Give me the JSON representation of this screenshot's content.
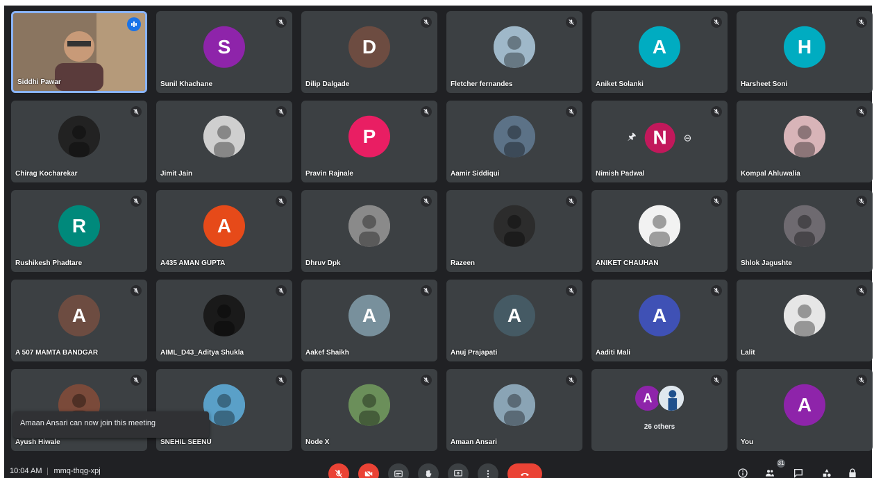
{
  "colors": {
    "background": "#202124",
    "tile": "#3c4043",
    "accent_blue": "#1a73e8",
    "red": "#ea4335"
  },
  "participants": [
    {
      "name": "Siddhi Pawar",
      "type": "video",
      "speaking": true
    },
    {
      "name": "Sunil Khachane",
      "initial": "S",
      "color": "#8e24aa"
    },
    {
      "name": "Dilip Dalgade",
      "initial": "D",
      "color": "#6d4c41"
    },
    {
      "name": "Fletcher fernandes",
      "type": "photo",
      "photo_color": "#9fb8c9"
    },
    {
      "name": "Aniket Solanki",
      "initial": "A",
      "color": "#00acc1"
    },
    {
      "name": "Harsheet Soni",
      "initial": "H",
      "color": "#00acc1"
    },
    {
      "name": "Chirag Kocharekar",
      "type": "photo",
      "photo_color": "#222222"
    },
    {
      "name": "Jimit Jain",
      "type": "photo",
      "photo_color": "#cfcfcf"
    },
    {
      "name": "Pravin Rajnale",
      "initial": "P",
      "color": "#e91e63"
    },
    {
      "name": "Aamir Siddiqui",
      "type": "photo",
      "photo_color": "#5c7287"
    },
    {
      "name": "Nimish Padwal",
      "initial": "N",
      "color": "#c2185b",
      "hovered": true
    },
    {
      "name": "Kompal Ahluwalia",
      "type": "photo",
      "photo_color": "#d8b4b8"
    },
    {
      "name": "Rushikesh Phadtare",
      "initial": "R",
      "color": "#00897b"
    },
    {
      "name": "A435 AMAN GUPTA",
      "initial": "A",
      "color": "#e64a19"
    },
    {
      "name": "Dhruv Dpk",
      "type": "photo",
      "photo_color": "#8a8a8a"
    },
    {
      "name": "Razeen",
      "type": "photo",
      "photo_color": "#2c2c2c"
    },
    {
      "name": "ANIKET CHAUHAN",
      "type": "photo",
      "photo_color": "#f2f2f2"
    },
    {
      "name": "Shlok Jagushte",
      "type": "photo",
      "photo_color": "#6e6a70"
    },
    {
      "name": "A 507 MAMTA BANDGAR",
      "initial": "A",
      "color": "#6d4c41"
    },
    {
      "name": "AIML_D43_Aditya Shukla",
      "type": "photo",
      "photo_color": "#1a1a1a"
    },
    {
      "name": "Aakef Shaikh",
      "initial": "A",
      "color": "#78909c"
    },
    {
      "name": "Anuj Prajapati",
      "initial": "A",
      "color": "#455a64"
    },
    {
      "name": "Aaditi Mali",
      "initial": "A",
      "color": "#3f51b5"
    },
    {
      "name": "Lalit",
      "type": "photo",
      "photo_color": "#e6e6e6"
    },
    {
      "name": "Ayush Hiwale",
      "type": "photo",
      "photo_color": "#7a4a3a"
    },
    {
      "name": "SNEHIL SEENU",
      "type": "photo",
      "photo_color": "#5aa0c8"
    },
    {
      "name": "Node X",
      "type": "photo",
      "photo_color": "#6b8f5a"
    },
    {
      "name": "Amaan Ansari",
      "type": "photo",
      "photo_color": "#8aa4b5"
    },
    {
      "name": "",
      "type": "others",
      "others_label": "26 others",
      "initial": "A",
      "color": "#8e24aa"
    },
    {
      "name": "You",
      "initial": "A",
      "color": "#8e24aa"
    }
  ],
  "notification": "Amaan Ansari can now join this meeting",
  "meeting": {
    "time": "10:04 AM",
    "code": "mmq-thqg-xpj"
  },
  "icons": {
    "mic": "mic-off-icon",
    "cam": "camera-off-icon",
    "cc": "captions-icon",
    "hand": "raise-hand-icon",
    "present": "present-screen-icon",
    "more": "more-options-icon",
    "hangup": "hangup-icon",
    "info": "info-icon",
    "people": "people-icon",
    "chat": "chat-icon",
    "activities": "activities-icon",
    "lock": "host-controls-icon"
  },
  "people_count": "31"
}
